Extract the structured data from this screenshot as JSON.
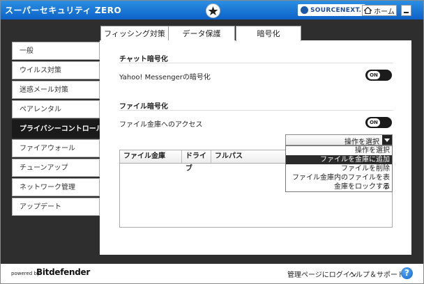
{
  "app": {
    "title": "スーパーセキュリティ ZERO",
    "home_label": "ホーム",
    "vendor": "SOURCENEXT."
  },
  "sidebar": {
    "items": [
      {
        "label": "一般"
      },
      {
        "label": "ウイルス対策"
      },
      {
        "label": "迷惑メール対策"
      },
      {
        "label": "ペアレンタル"
      },
      {
        "label": "プライバシーコントロール",
        "active": true
      },
      {
        "label": "ファイアウォール"
      },
      {
        "label": "チューンアップ"
      },
      {
        "label": "ネットワーク管理"
      },
      {
        "label": "アップデート"
      }
    ]
  },
  "tabs": [
    {
      "label": "フィッシング対策"
    },
    {
      "label": "データ保護"
    },
    {
      "label": "暗号化",
      "active": true
    }
  ],
  "sections": {
    "chat": {
      "title": "チャット暗号化",
      "setting": "Yahoo! Messengerの暗号化",
      "toggle": "ON"
    },
    "file": {
      "title": "ファイル暗号化",
      "setting": "ファイル金庫へのアクセス",
      "toggle": "ON"
    }
  },
  "operation_select": {
    "value": "操作を選択",
    "options": [
      "操作を選択",
      "ファイルを金庫に追加",
      "ファイルを削除",
      "ファイル金庫内のファイルを表示",
      "金庫をロックする"
    ],
    "highlighted": "ファイルを金庫に追加"
  },
  "table": {
    "columns": [
      "ファイル金庫",
      "ドライブ",
      "フルパス"
    ],
    "rows": []
  },
  "footer": {
    "powered_by": "powered by",
    "brand": "Bitdefender",
    "links": [
      "管理ページにログイン",
      "ヘルプ＆サポート"
    ],
    "help_icon": "?"
  },
  "colors": {
    "titlebar": "#1578d8",
    "sidebar_bg": "#2e2e2e",
    "active_item": "#1a1a1a"
  }
}
